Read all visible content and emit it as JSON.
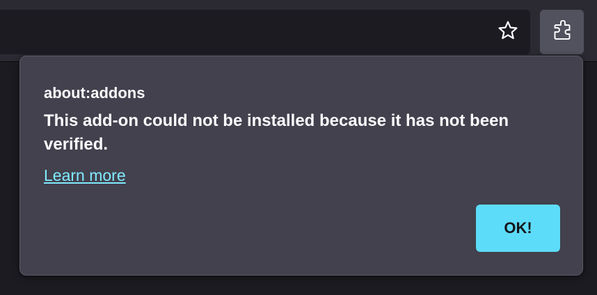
{
  "toolbar": {
    "bookmark_icon": "star-icon",
    "extensions_icon": "puzzle-piece-icon"
  },
  "notification": {
    "title": "about:addons",
    "message": "This add-on could not be installed because it has not been verified.",
    "link_label": "Learn more",
    "ok_label": "OK!"
  },
  "colors": {
    "panel_bg": "#42414d",
    "accent": "#5ddcf9",
    "link": "#80ebff",
    "text": "#fbfbfe"
  }
}
